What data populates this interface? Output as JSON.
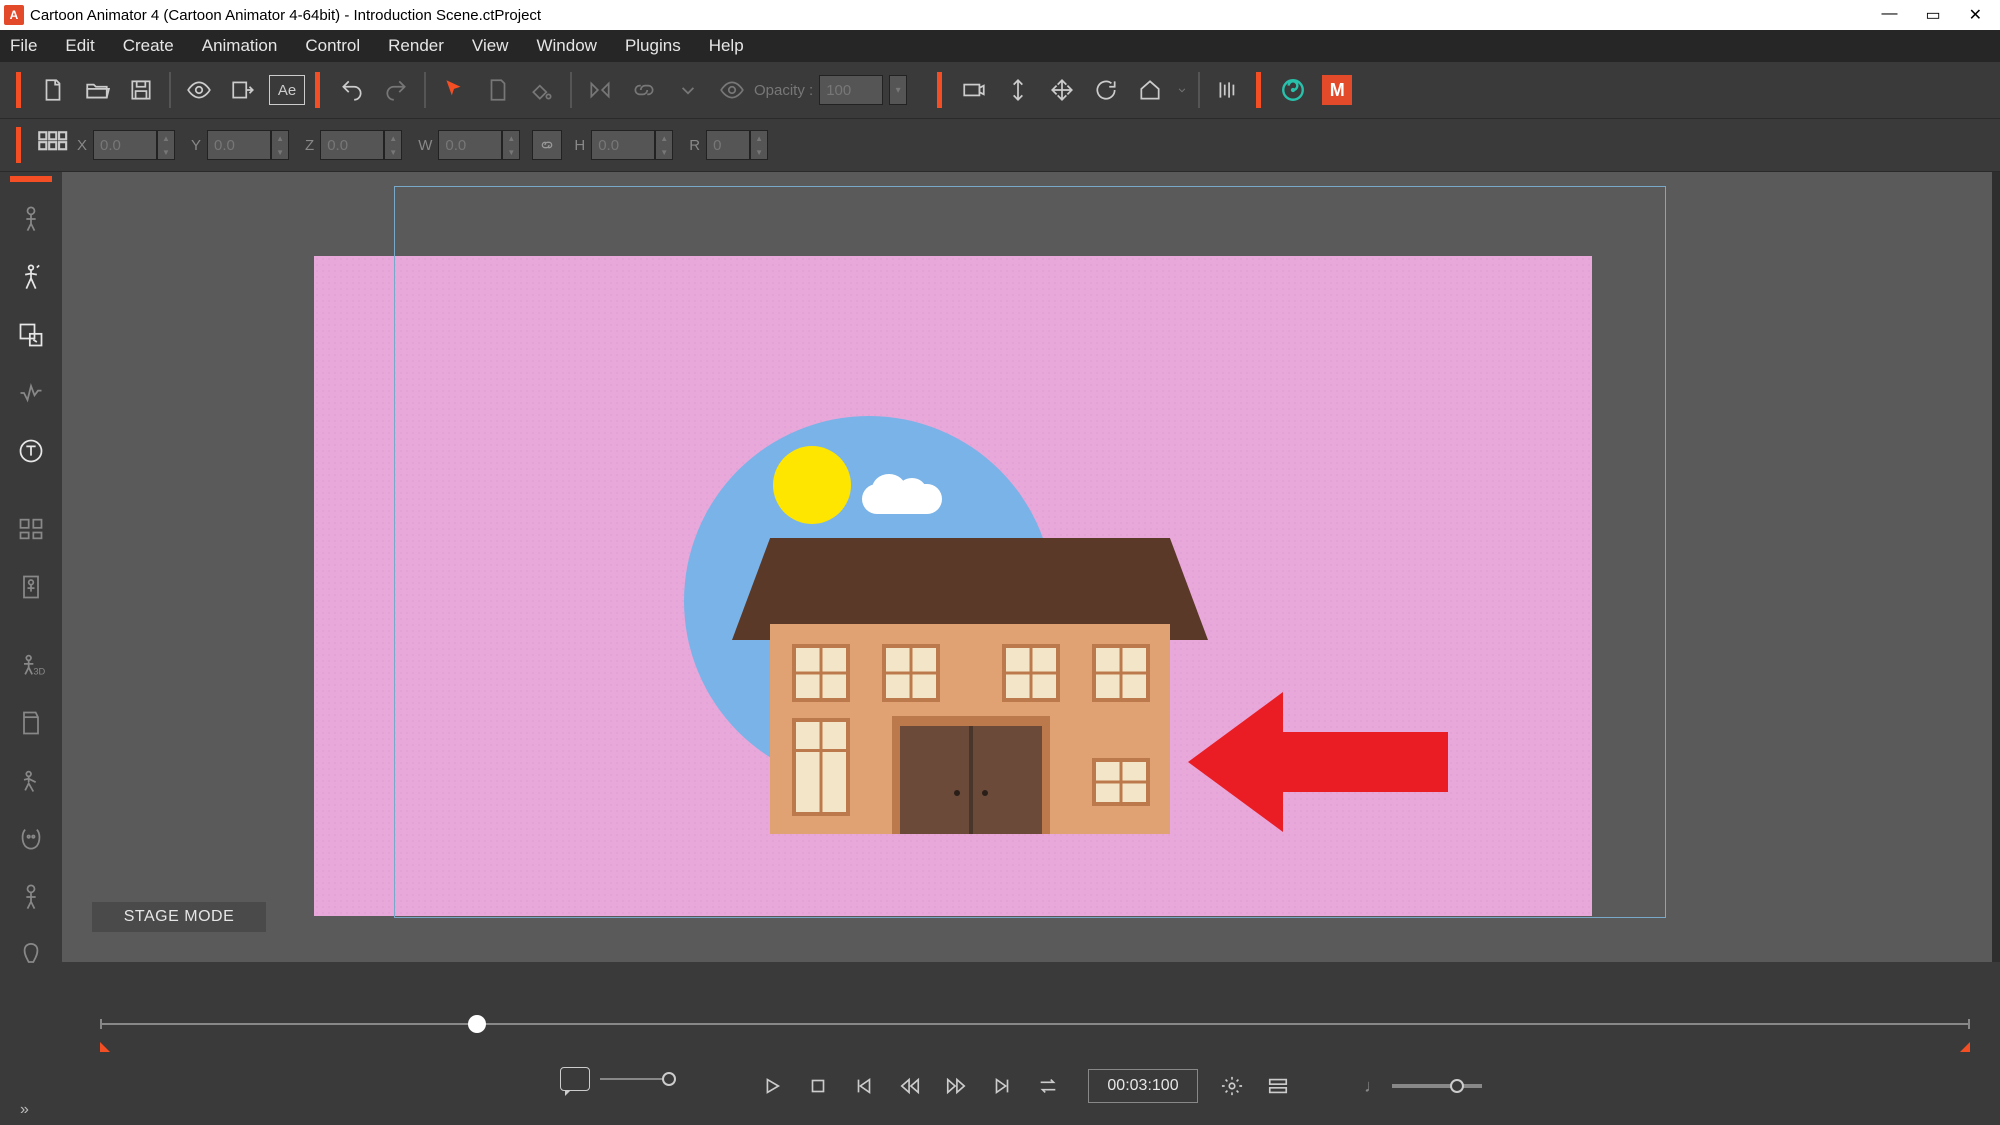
{
  "title_bar": {
    "app_icon_letter": "A",
    "title": "Cartoon Animator 4  (Cartoon Animator 4-64bit) - Introduction Scene.ctProject"
  },
  "menu": {
    "file": "File",
    "edit": "Edit",
    "create": "Create",
    "animation": "Animation",
    "control": "Control",
    "render": "Render",
    "view": "View",
    "window": "Window",
    "plugins": "Plugins",
    "help": "Help"
  },
  "toolbar": {
    "ae_label": "Ae",
    "opacity_label": "Opacity :",
    "opacity_value": "100",
    "m_badge": "M"
  },
  "transform": {
    "x_label": "X",
    "x_value": "0.0",
    "y_label": "Y",
    "y_value": "0.0",
    "z_label": "Z",
    "z_value": "0.0",
    "w_label": "W",
    "w_value": "0.0",
    "h_label": "H",
    "h_value": "0.0",
    "r_label": "R",
    "r_value": "0"
  },
  "stage": {
    "mode_label": "STAGE MODE"
  },
  "playback": {
    "time": "00:03:100"
  }
}
